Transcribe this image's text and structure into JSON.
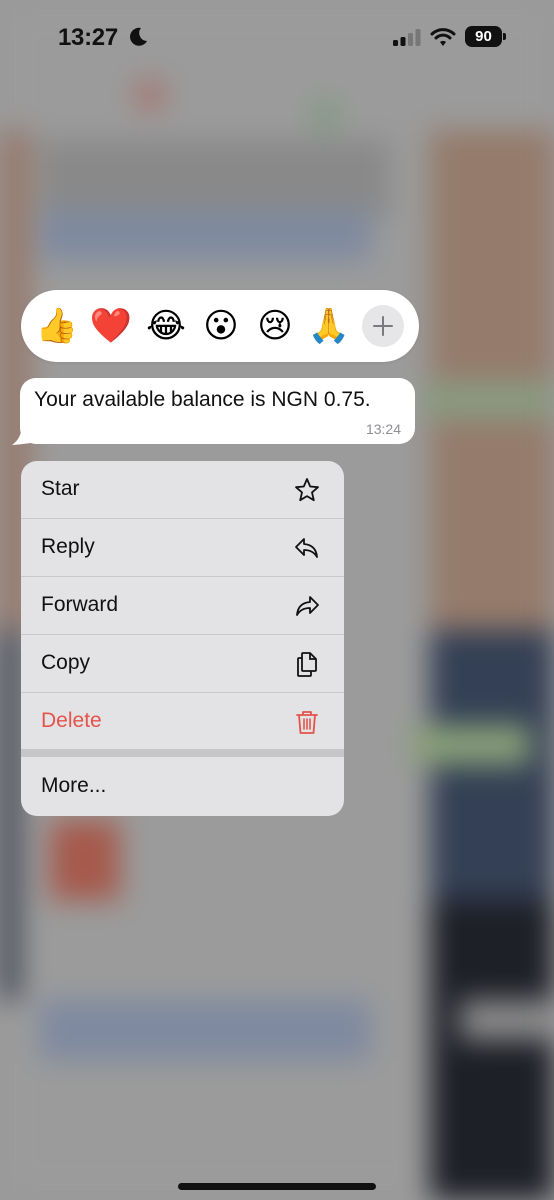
{
  "status_bar": {
    "time": "13:27",
    "focus_icon": "moon-icon",
    "signal_icon": "cellular-signal-icon",
    "wifi_icon": "wifi-icon",
    "battery_level": "90"
  },
  "reactions": {
    "emojis": [
      {
        "name": "thumbs-up",
        "char": "👍"
      },
      {
        "name": "red-heart",
        "char": "❤️"
      },
      {
        "name": "tears-of-joy",
        "char": "😂"
      },
      {
        "name": "surprised-face",
        "char": "😮"
      },
      {
        "name": "crying-face",
        "char": "😢"
      },
      {
        "name": "folded-hands",
        "char": "🙏"
      }
    ],
    "more_icon": "plus-icon"
  },
  "message": {
    "text": "Your available balance is NGN 0.75.",
    "time": "13:24"
  },
  "context_menu": {
    "items": [
      {
        "label": "Star",
        "icon": "star-icon"
      },
      {
        "label": "Reply",
        "icon": "reply-icon"
      },
      {
        "label": "Forward",
        "icon": "forward-icon"
      },
      {
        "label": "Copy",
        "icon": "copy-icon"
      },
      {
        "label": "Delete",
        "icon": "trash-icon",
        "color": "#e5534b"
      },
      {
        "label": "More...",
        "icon": ""
      }
    ]
  },
  "colors": {
    "destructive": "#e5534b",
    "menu_background": "#e3e3e5",
    "bubble_background": "#ffffff"
  }
}
